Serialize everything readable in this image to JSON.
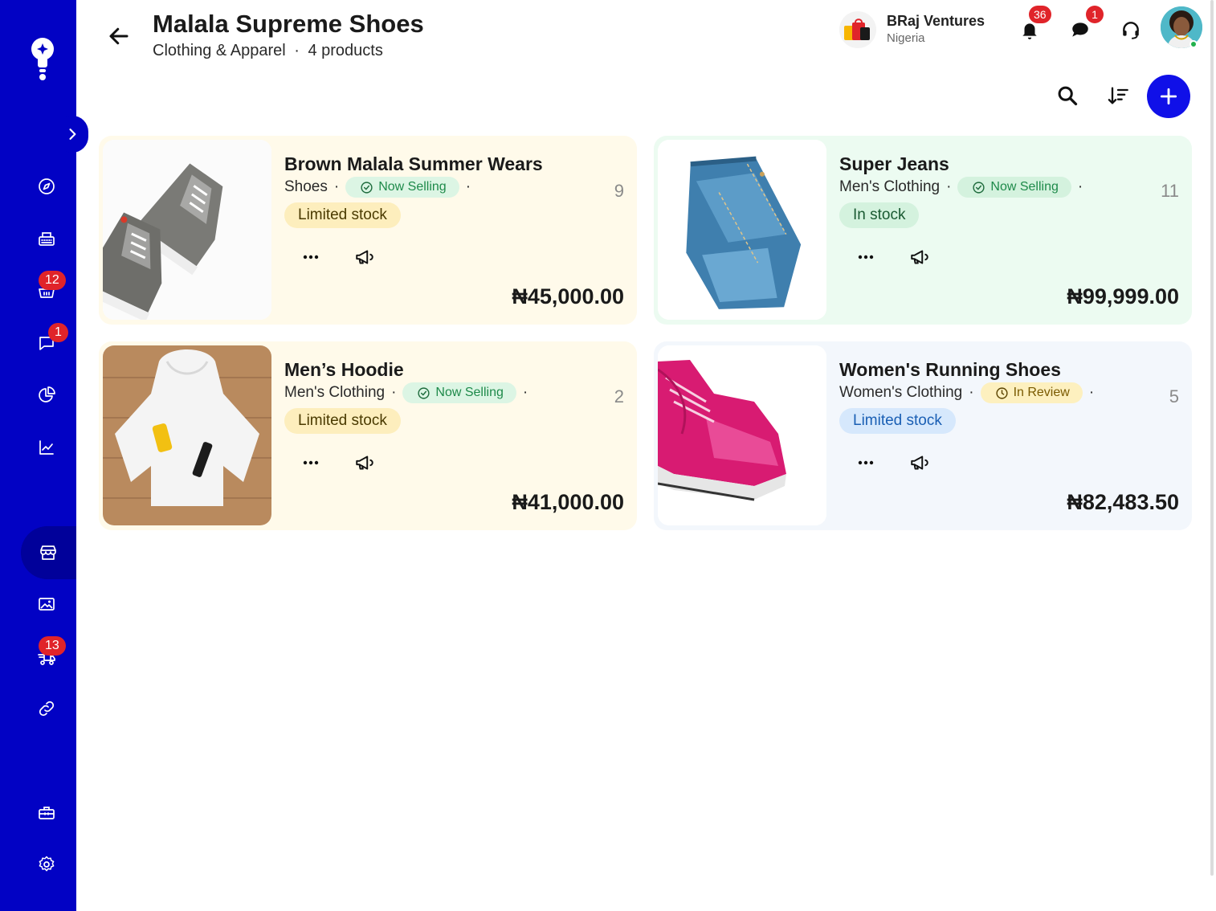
{
  "header": {
    "title": "Malala Supreme Shoes",
    "subtitle_category": "Clothing & Apparel",
    "subtitle_separator": "·",
    "subtitle_count": "4 products"
  },
  "account": {
    "business_name": "BRaj Ventures",
    "country": "Nigeria",
    "notifications_count": "36",
    "messages_count": "1"
  },
  "sidebar": {
    "cart_badge": "12",
    "chat_badge": "1",
    "delivery_badge": "13"
  },
  "colors": {
    "sidebar": "#0202c4",
    "accent": "#1010e8",
    "badge": "#e0242a",
    "card_yellow": "#fffaea",
    "card_green": "#ecfbf1",
    "card_blue": "#f3f7fc"
  },
  "products": [
    {
      "name": "Brown Malala Summer Wears",
      "category": "Shoes",
      "status": "Now Selling",
      "stock": "Limited stock",
      "count": "9",
      "price": "₦45,000.00",
      "image": "sneakers-image"
    },
    {
      "name": "Super Jeans",
      "category": "Men's Clothing",
      "status": "Now Selling",
      "stock": "In stock",
      "count": "11",
      "price": "₦99,999.00",
      "image": "jeans-image"
    },
    {
      "name": "Men’s Hoodie",
      "category": "Men's Clothing",
      "status": "Now Selling",
      "stock": "Limited stock",
      "count": "2",
      "price": "₦41,000.00",
      "image": "hoodie-image"
    },
    {
      "name": "Women's Running Shoes",
      "category": "Women's Clothing",
      "status": "In Review",
      "stock": "Limited stock",
      "count": "5",
      "price": "₦82,483.50",
      "image": "pink-shoes-image"
    }
  ]
}
